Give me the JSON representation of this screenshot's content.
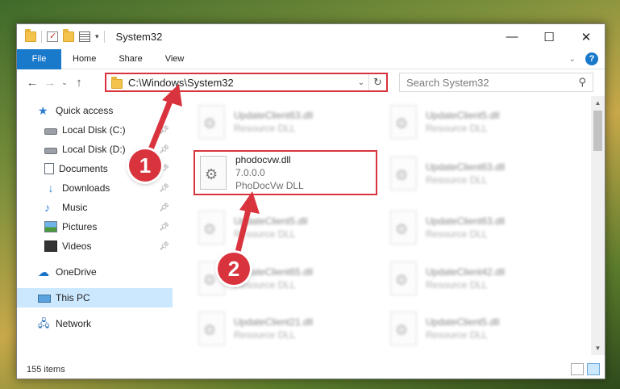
{
  "window": {
    "title": "System32"
  },
  "ribbon": {
    "tabs": [
      "File",
      "Home",
      "Share",
      "View"
    ],
    "help": "?"
  },
  "nav": {
    "back": "←",
    "forward": "→",
    "recent": "⌄",
    "up": "↑"
  },
  "address": {
    "path": "C:\\Windows\\System32",
    "dropdown": "⌄",
    "refresh": "↻"
  },
  "search": {
    "placeholder": "Search System32"
  },
  "sidebar": {
    "items": [
      {
        "label": "Quick access",
        "icon": "star-icon"
      },
      {
        "label": "Local Disk (C:)",
        "icon": "disk-icon",
        "pinned": true
      },
      {
        "label": "Local Disk (D:)",
        "icon": "disk-icon",
        "pinned": true
      },
      {
        "label": "Documents",
        "icon": "documents-icon",
        "pinned": true
      },
      {
        "label": "Downloads",
        "icon": "downloads-icon",
        "pinned": true
      },
      {
        "label": "Music",
        "icon": "music-icon",
        "pinned": true
      },
      {
        "label": "Pictures",
        "icon": "pictures-icon",
        "pinned": true
      },
      {
        "label": "Videos",
        "icon": "videos-icon",
        "pinned": true
      },
      {
        "label": "OneDrive",
        "icon": "onedrive-icon"
      },
      {
        "label": "This PC",
        "icon": "this-pc-icon",
        "selected": true
      },
      {
        "label": "Network",
        "icon": "network-icon"
      }
    ]
  },
  "files": [
    {
      "name": "UpdateClient63.dll",
      "sub": "Resource DLL"
    },
    {
      "name": "UpdateClient5.dll",
      "sub": "Resource DLL"
    },
    {
      "name": "phodocvw.dll",
      "version": "7.0.0.0",
      "sub": "PhoDocVw DLL"
    },
    {
      "name": "UpdateClient63.dll",
      "sub": "Resource DLL"
    },
    {
      "name": "UpdateClient5.dll",
      "sub": "Resource DLL"
    },
    {
      "name": "UpdateClient63.dll",
      "sub": "Resource DLL"
    },
    {
      "name": "UpdateClient65.dll",
      "sub": "Resource DLL"
    },
    {
      "name": "UpdateClient42.dll",
      "sub": "Resource DLL"
    },
    {
      "name": "UpdateClient21.dll",
      "sub": "Resource DLL"
    },
    {
      "name": "UpdateClient5.dll",
      "sub": "Resource DLL"
    }
  ],
  "status": {
    "count": "155 items"
  },
  "annotations": {
    "step1": "1",
    "step2": "2"
  },
  "colors": {
    "accent": "#1979ca",
    "highlight": "#d9343e",
    "selected": "#cce8ff"
  }
}
